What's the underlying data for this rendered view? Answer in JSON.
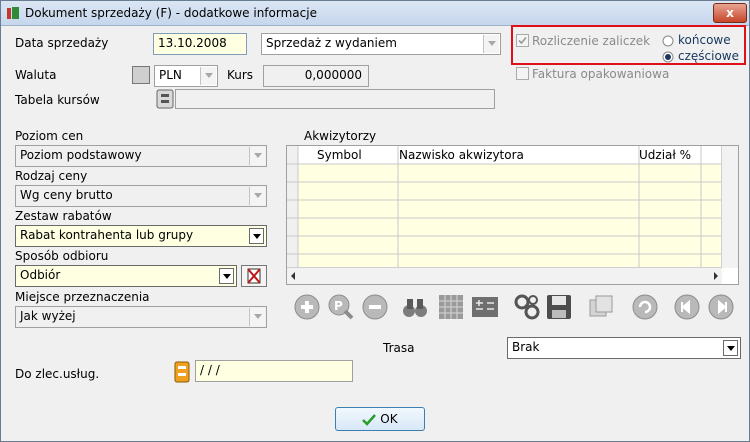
{
  "window": {
    "title": "Dokument sprzedaży (F) - dodatkowe informacje",
    "close_glyph": "x"
  },
  "fields": {
    "data_sprzedazy": {
      "label": "Data sprzedaży",
      "value": "13.10.2008"
    },
    "typ_sprzedazy": {
      "value": "Sprzedaż z wydaniem"
    },
    "waluta": {
      "label": "Waluta",
      "value": "PLN"
    },
    "kurs": {
      "label": "Kurs",
      "value": "0,000000"
    },
    "tabela_kursow": {
      "label": "Tabela kursów",
      "value": ""
    },
    "rozliczenie_zaliczek": {
      "label": "Rozliczenie zaliczek",
      "checked": true,
      "options": [
        "końcowe",
        "częściowe"
      ],
      "selected": "częściowe"
    },
    "faktura_opakowaniowa": {
      "label": "Faktura opakowaniowa",
      "checked": false
    },
    "poziom_cen": {
      "label": "Poziom cen",
      "value": "Poziom podstawowy"
    },
    "rodzaj_ceny": {
      "label": "Rodzaj ceny",
      "value": "Wg ceny brutto"
    },
    "zestaw_rabatow": {
      "label": "Zestaw rabatów",
      "value": "Rabat kontrahenta lub grupy"
    },
    "sposob_odbioru": {
      "label": "Sposób odbioru",
      "value": "Odbiór"
    },
    "miejsce_przeznaczenia": {
      "label": "Miejsce przeznaczenia",
      "value": "Jak wyżej"
    },
    "trasa": {
      "label": "Trasa",
      "value": "Brak"
    },
    "do_zlec": {
      "label": "Do zlec.usług.",
      "value": "/   /   /"
    }
  },
  "akwizytorzy": {
    "label": "Akwizytorzy",
    "columns": [
      "Symbol",
      "Nazwisko akwizytora",
      "Udział %"
    ],
    "rows": []
  },
  "toolbar": {
    "icons": [
      "add-icon",
      "search-icon",
      "remove-icon",
      "binoculars-icon",
      "table-icon",
      "calculator-icon",
      "gears-icon",
      "save-icon",
      "copy-icon",
      "refresh-icon",
      "first-icon",
      "last-icon"
    ]
  },
  "ok_button": {
    "label": "OK"
  },
  "colors": {
    "highlight": "#e0101a",
    "yellow_field": "#ffffe1",
    "radio_dot": "#17375e"
  }
}
